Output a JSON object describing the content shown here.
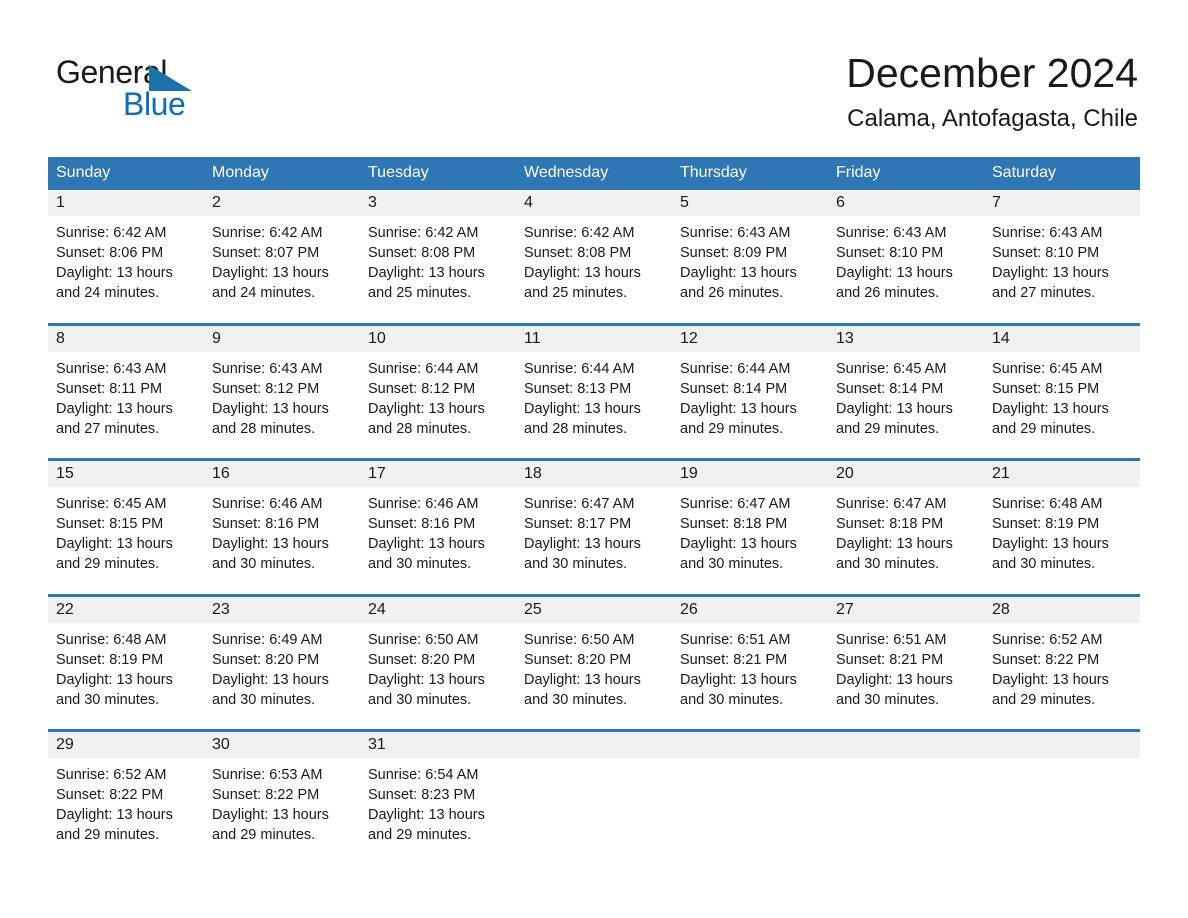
{
  "logo": {
    "word_one": "General",
    "word_two": "Blue",
    "triangle_icon": "triangle-icon",
    "brand_blue": "#0f6cb5",
    "header_blue": "#2f76b4"
  },
  "header": {
    "month_title": "December 2024",
    "location": "Calama, Antofagasta, Chile"
  },
  "weekday_headers": [
    "Sunday",
    "Monday",
    "Tuesday",
    "Wednesday",
    "Thursday",
    "Friday",
    "Saturday"
  ],
  "weeks": [
    {
      "numbers": [
        "1",
        "2",
        "3",
        "4",
        "5",
        "6",
        "7"
      ],
      "cells": [
        {
          "sunrise": "Sunrise: 6:42 AM",
          "sunset": "Sunset: 8:06 PM",
          "daylight_a": "Daylight: 13 hours",
          "daylight_b": "and 24 minutes."
        },
        {
          "sunrise": "Sunrise: 6:42 AM",
          "sunset": "Sunset: 8:07 PM",
          "daylight_a": "Daylight: 13 hours",
          "daylight_b": "and 24 minutes."
        },
        {
          "sunrise": "Sunrise: 6:42 AM",
          "sunset": "Sunset: 8:08 PM",
          "daylight_a": "Daylight: 13 hours",
          "daylight_b": "and 25 minutes."
        },
        {
          "sunrise": "Sunrise: 6:42 AM",
          "sunset": "Sunset: 8:08 PM",
          "daylight_a": "Daylight: 13 hours",
          "daylight_b": "and 25 minutes."
        },
        {
          "sunrise": "Sunrise: 6:43 AM",
          "sunset": "Sunset: 8:09 PM",
          "daylight_a": "Daylight: 13 hours",
          "daylight_b": "and 26 minutes."
        },
        {
          "sunrise": "Sunrise: 6:43 AM",
          "sunset": "Sunset: 8:10 PM",
          "daylight_a": "Daylight: 13 hours",
          "daylight_b": "and 26 minutes."
        },
        {
          "sunrise": "Sunrise: 6:43 AM",
          "sunset": "Sunset: 8:10 PM",
          "daylight_a": "Daylight: 13 hours",
          "daylight_b": "and 27 minutes."
        }
      ]
    },
    {
      "numbers": [
        "8",
        "9",
        "10",
        "11",
        "12",
        "13",
        "14"
      ],
      "cells": [
        {
          "sunrise": "Sunrise: 6:43 AM",
          "sunset": "Sunset: 8:11 PM",
          "daylight_a": "Daylight: 13 hours",
          "daylight_b": "and 27 minutes."
        },
        {
          "sunrise": "Sunrise: 6:43 AM",
          "sunset": "Sunset: 8:12 PM",
          "daylight_a": "Daylight: 13 hours",
          "daylight_b": "and 28 minutes."
        },
        {
          "sunrise": "Sunrise: 6:44 AM",
          "sunset": "Sunset: 8:12 PM",
          "daylight_a": "Daylight: 13 hours",
          "daylight_b": "and 28 minutes."
        },
        {
          "sunrise": "Sunrise: 6:44 AM",
          "sunset": "Sunset: 8:13 PM",
          "daylight_a": "Daylight: 13 hours",
          "daylight_b": "and 28 minutes."
        },
        {
          "sunrise": "Sunrise: 6:44 AM",
          "sunset": "Sunset: 8:14 PM",
          "daylight_a": "Daylight: 13 hours",
          "daylight_b": "and 29 minutes."
        },
        {
          "sunrise": "Sunrise: 6:45 AM",
          "sunset": "Sunset: 8:14 PM",
          "daylight_a": "Daylight: 13 hours",
          "daylight_b": "and 29 minutes."
        },
        {
          "sunrise": "Sunrise: 6:45 AM",
          "sunset": "Sunset: 8:15 PM",
          "daylight_a": "Daylight: 13 hours",
          "daylight_b": "and 29 minutes."
        }
      ]
    },
    {
      "numbers": [
        "15",
        "16",
        "17",
        "18",
        "19",
        "20",
        "21"
      ],
      "cells": [
        {
          "sunrise": "Sunrise: 6:45 AM",
          "sunset": "Sunset: 8:15 PM",
          "daylight_a": "Daylight: 13 hours",
          "daylight_b": "and 29 minutes."
        },
        {
          "sunrise": "Sunrise: 6:46 AM",
          "sunset": "Sunset: 8:16 PM",
          "daylight_a": "Daylight: 13 hours",
          "daylight_b": "and 30 minutes."
        },
        {
          "sunrise": "Sunrise: 6:46 AM",
          "sunset": "Sunset: 8:16 PM",
          "daylight_a": "Daylight: 13 hours",
          "daylight_b": "and 30 minutes."
        },
        {
          "sunrise": "Sunrise: 6:47 AM",
          "sunset": "Sunset: 8:17 PM",
          "daylight_a": "Daylight: 13 hours",
          "daylight_b": "and 30 minutes."
        },
        {
          "sunrise": "Sunrise: 6:47 AM",
          "sunset": "Sunset: 8:18 PM",
          "daylight_a": "Daylight: 13 hours",
          "daylight_b": "and 30 minutes."
        },
        {
          "sunrise": "Sunrise: 6:47 AM",
          "sunset": "Sunset: 8:18 PM",
          "daylight_a": "Daylight: 13 hours",
          "daylight_b": "and 30 minutes."
        },
        {
          "sunrise": "Sunrise: 6:48 AM",
          "sunset": "Sunset: 8:19 PM",
          "daylight_a": "Daylight: 13 hours",
          "daylight_b": "and 30 minutes."
        }
      ]
    },
    {
      "numbers": [
        "22",
        "23",
        "24",
        "25",
        "26",
        "27",
        "28"
      ],
      "cells": [
        {
          "sunrise": "Sunrise: 6:48 AM",
          "sunset": "Sunset: 8:19 PM",
          "daylight_a": "Daylight: 13 hours",
          "daylight_b": "and 30 minutes."
        },
        {
          "sunrise": "Sunrise: 6:49 AM",
          "sunset": "Sunset: 8:20 PM",
          "daylight_a": "Daylight: 13 hours",
          "daylight_b": "and 30 minutes."
        },
        {
          "sunrise": "Sunrise: 6:50 AM",
          "sunset": "Sunset: 8:20 PM",
          "daylight_a": "Daylight: 13 hours",
          "daylight_b": "and 30 minutes."
        },
        {
          "sunrise": "Sunrise: 6:50 AM",
          "sunset": "Sunset: 8:20 PM",
          "daylight_a": "Daylight: 13 hours",
          "daylight_b": "and 30 minutes."
        },
        {
          "sunrise": "Sunrise: 6:51 AM",
          "sunset": "Sunset: 8:21 PM",
          "daylight_a": "Daylight: 13 hours",
          "daylight_b": "and 30 minutes."
        },
        {
          "sunrise": "Sunrise: 6:51 AM",
          "sunset": "Sunset: 8:21 PM",
          "daylight_a": "Daylight: 13 hours",
          "daylight_b": "and 30 minutes."
        },
        {
          "sunrise": "Sunrise: 6:52 AM",
          "sunset": "Sunset: 8:22 PM",
          "daylight_a": "Daylight: 13 hours",
          "daylight_b": "and 29 minutes."
        }
      ]
    },
    {
      "numbers": [
        "29",
        "30",
        "31",
        "",
        "",
        "",
        ""
      ],
      "cells": [
        {
          "sunrise": "Sunrise: 6:52 AM",
          "sunset": "Sunset: 8:22 PM",
          "daylight_a": "Daylight: 13 hours",
          "daylight_b": "and 29 minutes."
        },
        {
          "sunrise": "Sunrise: 6:53 AM",
          "sunset": "Sunset: 8:22 PM",
          "daylight_a": "Daylight: 13 hours",
          "daylight_b": "and 29 minutes."
        },
        {
          "sunrise": "Sunrise: 6:54 AM",
          "sunset": "Sunset: 8:23 PM",
          "daylight_a": "Daylight: 13 hours",
          "daylight_b": "and 29 minutes."
        },
        {
          "sunrise": "",
          "sunset": "",
          "daylight_a": "",
          "daylight_b": ""
        },
        {
          "sunrise": "",
          "sunset": "",
          "daylight_a": "",
          "daylight_b": ""
        },
        {
          "sunrise": "",
          "sunset": "",
          "daylight_a": "",
          "daylight_b": ""
        },
        {
          "sunrise": "",
          "sunset": "",
          "daylight_a": "",
          "daylight_b": ""
        }
      ]
    }
  ]
}
